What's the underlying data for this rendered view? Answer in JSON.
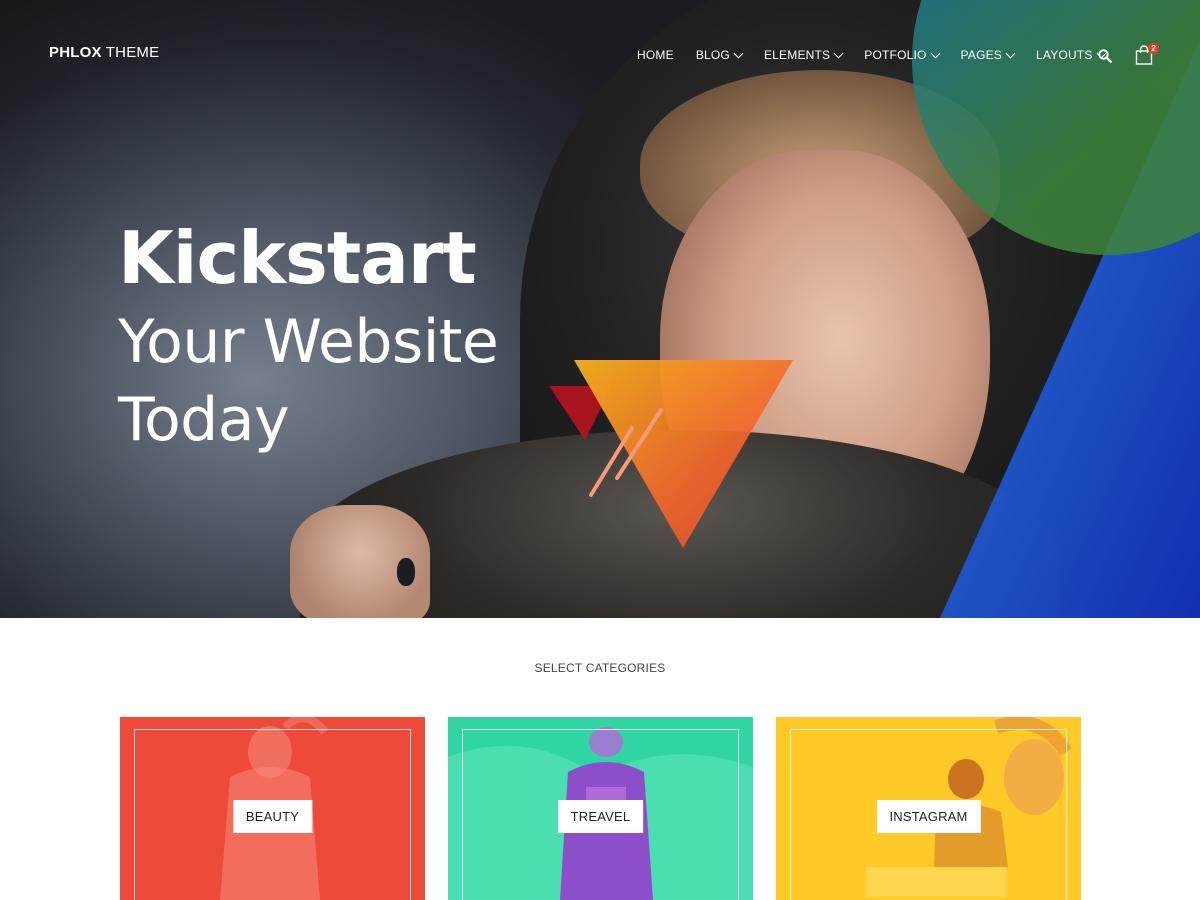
{
  "header": {
    "logo_bold": "PHLOX",
    "logo_light": "THEME",
    "nav": [
      {
        "label": "HOME",
        "has_dropdown": false
      },
      {
        "label": "BLOG",
        "has_dropdown": true
      },
      {
        "label": "ELEMENTS",
        "has_dropdown": true
      },
      {
        "label": "POTFOLIO",
        "has_dropdown": true
      },
      {
        "label": "PAGES",
        "has_dropdown": true
      },
      {
        "label": "LAYOUTS",
        "has_dropdown": true
      }
    ],
    "cart_count": "2",
    "icons": [
      "search-icon",
      "shopping-bag-icon"
    ]
  },
  "hero": {
    "line1": "Kickstart",
    "line2": "Your Website",
    "line3": "Today"
  },
  "categories": {
    "heading": "SELECT CATEGORIES",
    "items": [
      {
        "label": "BEAUTY",
        "color": "#ee4a3a"
      },
      {
        "label": "TREAVEL",
        "color": "#2fd6a4"
      },
      {
        "label": "INSTAGRAM",
        "color": "#ffc928"
      }
    ]
  },
  "colors": {
    "accent_orange": "#f7941d",
    "accent_red": "#c4161c",
    "accent_blue": "#1f4fd8",
    "accent_green": "#3c823c"
  }
}
